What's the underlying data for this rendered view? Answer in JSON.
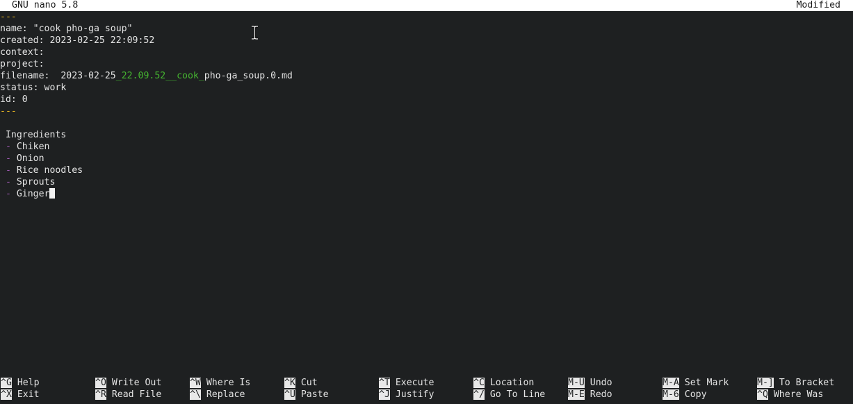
{
  "titlebar": {
    "app": "GNU nano 5.8",
    "status": "Modified"
  },
  "editor": {
    "frontmatter_open": "---",
    "name_line": "name: \"cook pho-ga soup\"",
    "created_line": "created: 2023-02-25 22:09:52",
    "context_line": "context:",
    "project_line": "project:",
    "filename_key": "filename:  ",
    "filename_part1": "2023-02-25",
    "filename_part2": "_22.09.52__cook_",
    "filename_part3": "pho-ga_soup.0.md",
    "status_line": "status: work",
    "id_line": "id: 0",
    "frontmatter_close": "---",
    "heading": " Ingredients",
    "bullet": " -",
    "items": [
      "Chiken",
      "Onion",
      "Rice noodles",
      "Sprouts",
      "Ginger"
    ]
  },
  "shortcuts": {
    "row1": [
      {
        "key": "^G",
        "label": "Help"
      },
      {
        "key": "^O",
        "label": "Write Out"
      },
      {
        "key": "^W",
        "label": "Where Is"
      },
      {
        "key": "^K",
        "label": "Cut"
      },
      {
        "key": "^T",
        "label": "Execute"
      },
      {
        "key": "^C",
        "label": "Location"
      },
      {
        "key": "M-U",
        "label": "Undo"
      },
      {
        "key": "M-A",
        "label": "Set Mark"
      },
      {
        "key": "M-]",
        "label": "To Bracket"
      }
    ],
    "row2": [
      {
        "key": "^X",
        "label": "Exit"
      },
      {
        "key": "^R",
        "label": "Read File"
      },
      {
        "key": "^\\",
        "label": "Replace"
      },
      {
        "key": "^U",
        "label": "Paste"
      },
      {
        "key": "^J",
        "label": "Justify"
      },
      {
        "key": "^/",
        "label": "Go To Line"
      },
      {
        "key": "M-E",
        "label": "Redo"
      },
      {
        "key": "M-6",
        "label": "Copy"
      },
      {
        "key": "^Q",
        "label": "Where Was"
      }
    ]
  }
}
